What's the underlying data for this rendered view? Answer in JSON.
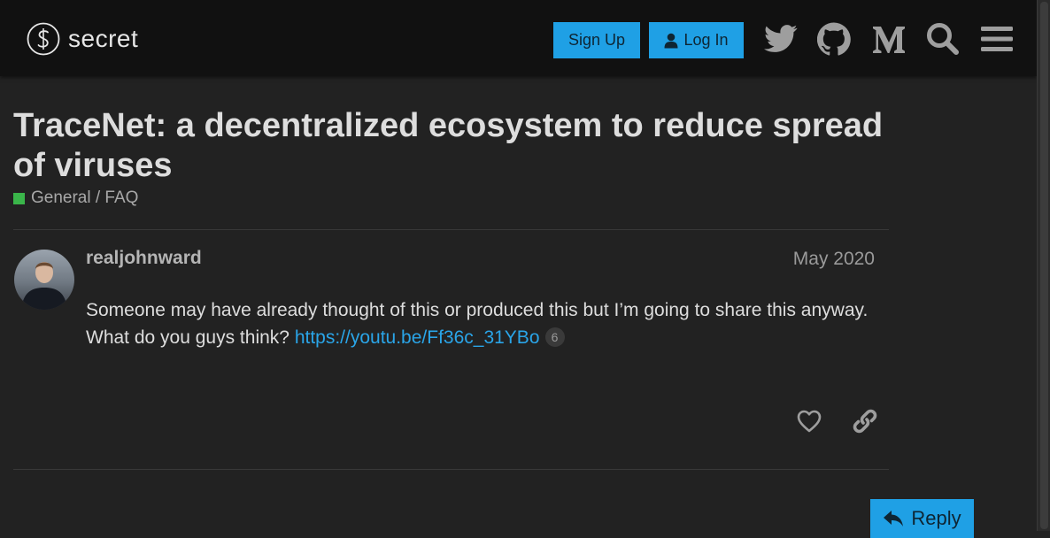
{
  "header": {
    "site_name": "secret",
    "signup_label": "Sign Up",
    "login_label": "Log In",
    "icons": [
      "twitter-icon",
      "github-icon",
      "medium-icon",
      "search-icon",
      "hamburger-menu-icon"
    ]
  },
  "topic": {
    "title": "TraceNet: a decentralized ecosystem to reduce spread of viruses",
    "category": "General / FAQ",
    "category_color": "#3ab54a"
  },
  "post": {
    "username": "realjohnward",
    "date": "May 2020",
    "body_text": "Someone may have already thought of this or produced this but I’m going to share this anyway. What do you guys think? ",
    "link_text": "https://youtu.be/Ff36c_31YBo",
    "link_clicks": "6"
  },
  "actions": {
    "like_icon": "heart-icon",
    "share_icon": "link-icon",
    "reply_label": "Reply"
  },
  "colors": {
    "accent": "#1fa0e5",
    "background": "#222222",
    "header_background": "#111111",
    "link": "#2aa5e8"
  }
}
